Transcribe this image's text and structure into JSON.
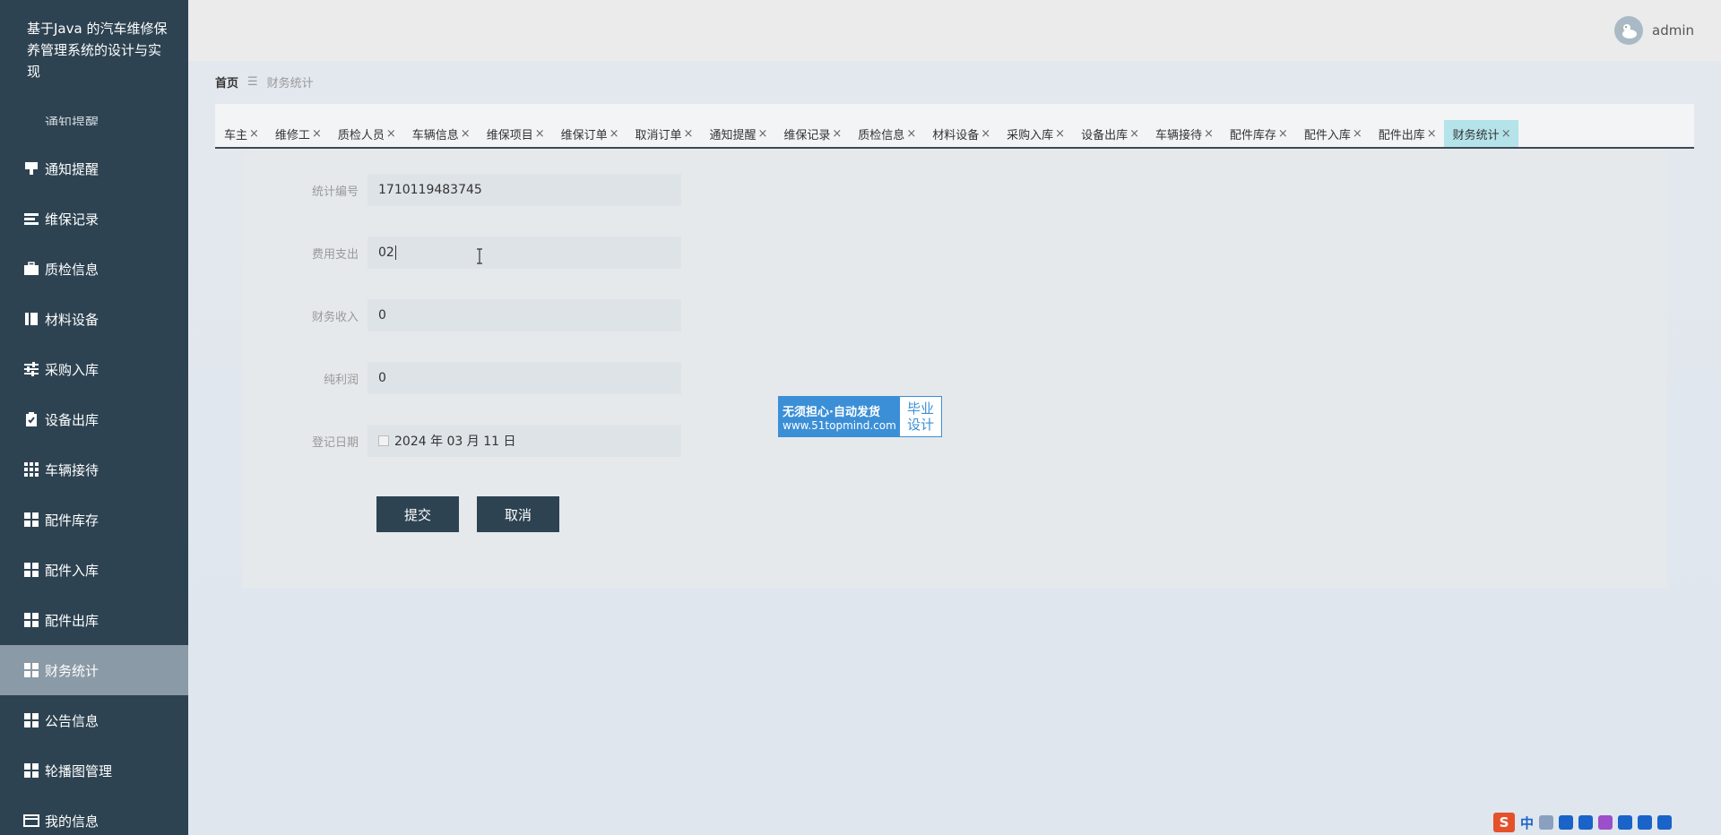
{
  "app": {
    "title": "基于Java 的汽车维修保养管理系统的设计与实现",
    "cut_item": "通知提醒"
  },
  "sidebar": {
    "items": [
      {
        "label": "通知提醒",
        "icon": "bell-icon"
      },
      {
        "label": "维保记录",
        "icon": "list-icon"
      },
      {
        "label": "质检信息",
        "icon": "briefcase-icon"
      },
      {
        "label": "材料设备",
        "icon": "book-icon"
      },
      {
        "label": "采购入库",
        "icon": "sliders-icon"
      },
      {
        "label": "设备出库",
        "icon": "clipboard-check-icon"
      },
      {
        "label": "车辆接待",
        "icon": "grid-icon"
      },
      {
        "label": "配件库存",
        "icon": "grid-icon"
      },
      {
        "label": "配件入库",
        "icon": "grid-icon"
      },
      {
        "label": "配件出库",
        "icon": "grid-icon"
      },
      {
        "label": "财务统计",
        "icon": "grid-icon",
        "active": true
      },
      {
        "label": "公告信息",
        "icon": "grid-icon"
      },
      {
        "label": "轮播图管理",
        "icon": "grid-icon"
      },
      {
        "label": "我的信息",
        "icon": "card-icon"
      }
    ]
  },
  "header": {
    "username": "admin"
  },
  "breadcrumb": {
    "home": "首页",
    "sep": "☰",
    "current": "财务统计"
  },
  "tabs": [
    "车主",
    "维修工",
    "质检人员",
    "车辆信息",
    "维保项目",
    "维保订单",
    "取消订单",
    "通知提醒",
    "维保记录",
    "质检信息",
    "材料设备",
    "采购入库",
    "设备出库",
    "车辆接待",
    "配件库存",
    "配件入库",
    "配件出库",
    "财务统计"
  ],
  "active_tab": "财务统计",
  "tab_close": "×",
  "form": {
    "fields": [
      {
        "label": "统计编号",
        "value": "1710119483745"
      },
      {
        "label": "费用支出",
        "value": "02"
      },
      {
        "label": "财务收入",
        "value": "0"
      },
      {
        "label": "纯利润",
        "value": "0"
      },
      {
        "label": "登记日期",
        "value": "2024 年 03 月 11 日"
      }
    ],
    "submit_label": "提交",
    "cancel_label": "取消"
  },
  "watermark": {
    "line1": "无须担心·自动发货",
    "line2": "www.51topmind.com",
    "right1": "毕业",
    "right2": "设计"
  },
  "tray": {
    "ime_logo": "S",
    "ime_lang": "中"
  },
  "colors": {
    "sidebar_bg": "#2e4352",
    "active_menu_bg": "#8a9aa6",
    "active_tab_bg": "#b4e3ea",
    "button_bg": "#2e4352",
    "watermark_blue": "#3b8fd6"
  }
}
